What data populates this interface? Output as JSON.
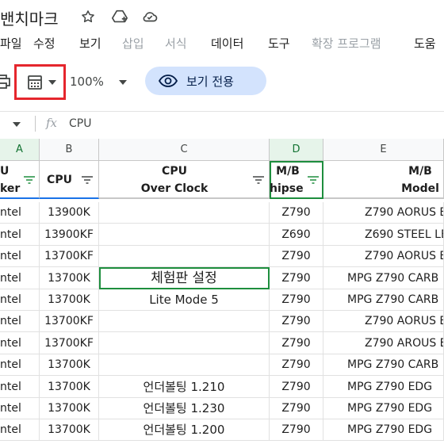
{
  "title_bar": {
    "doc_title": "밴치마크",
    "icons": [
      "star-icon",
      "add-to-drive-icon",
      "cloud-status-icon"
    ]
  },
  "menu": {
    "items": [
      {
        "label": "파일",
        "disabled": false
      },
      {
        "label": "수정",
        "disabled": false
      },
      {
        "label": "보기",
        "disabled": false
      },
      {
        "label": "삽입",
        "disabled": true
      },
      {
        "label": "서식",
        "disabled": true
      },
      {
        "label": "데이터",
        "disabled": false
      },
      {
        "label": "도구",
        "disabled": false
      },
      {
        "label": "확장 프로그램",
        "disabled": true
      },
      {
        "label": "도움",
        "disabled": false
      }
    ]
  },
  "toolbar": {
    "icons": [
      "print-icon",
      "calculator-icon",
      "dropdown-arrow-icon"
    ],
    "zoom": "100%",
    "view_only_label": "보기 전용",
    "highlight_color": "#e5262d"
  },
  "formula_bar": {
    "cell_ref": "",
    "fx": "fx",
    "content": "CPU"
  },
  "columns": {
    "letters": [
      "A",
      "B",
      "C",
      "D",
      "E"
    ],
    "selected": [
      "A",
      "D"
    ]
  },
  "header_row": {
    "a_line1": "U",
    "a_line2": "ker",
    "b": "CPU",
    "c_line1": "CPU",
    "c_line2": "Over Clock",
    "d_line1": "M/B",
    "d_line2": "hipse",
    "e_line1": "M/B",
    "e_line2": "Model"
  },
  "rows": [
    {
      "a": "ntel",
      "b": "13900K",
      "c": "",
      "d": "Z790",
      "e": "Z790 AORUS E"
    },
    {
      "a": "ntel",
      "b": "13900KF",
      "c": "",
      "d": "Z690",
      "e": "Z690 STEEL LE"
    },
    {
      "a": "ntel",
      "b": "13700KF",
      "c": "",
      "d": "Z790",
      "e": "Z790 AORUS E"
    },
    {
      "a": "ntel",
      "b": "13700K",
      "c": "체험판 설정",
      "d": "Z790",
      "e": "MPG Z790 CARB"
    },
    {
      "a": "ntel",
      "b": "13700K",
      "c": "Lite Mode 5",
      "d": "Z790",
      "e": "MPG Z790 CARB"
    },
    {
      "a": "ntel",
      "b": "13700KF",
      "c": "",
      "d": "Z790",
      "e": "Z790 AORUS E"
    },
    {
      "a": "ntel",
      "b": "13700KF",
      "c": "",
      "d": "Z790",
      "e": "Z790 AROUS E"
    },
    {
      "a": "ntel",
      "b": "13700K",
      "c": "",
      "d": "Z790",
      "e": "MPG Z790 CARB"
    },
    {
      "a": "ntel",
      "b": "13700K",
      "c": "언더볼팅 1.210",
      "d": "Z790",
      "e": "MPG Z790 EDG"
    },
    {
      "a": "ntel",
      "b": "13700K",
      "c": "언더볼팅 1.230",
      "d": "Z790",
      "e": "MPG Z790 EDG"
    },
    {
      "a": "ntel",
      "b": "13700K",
      "c": "언더볼팅 1.200",
      "d": "Z790",
      "e": "MPG Z790 EDG"
    }
  ]
}
